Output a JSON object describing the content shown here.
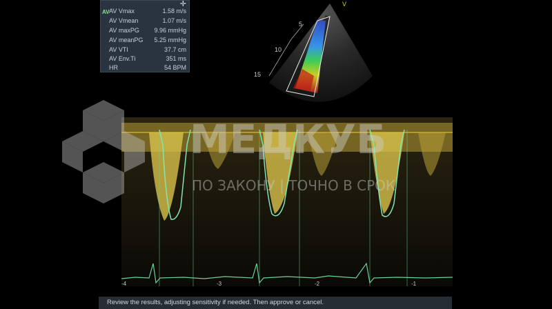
{
  "measurements": {
    "tag": "AV",
    "rows": [
      {
        "name": "AV Vmax",
        "value": "1.58 m/s"
      },
      {
        "name": "AV Vmean",
        "value": "1.07 m/s"
      },
      {
        "name": "AV maxPG",
        "value": "9.96 mmHg"
      },
      {
        "name": "AV meanPG",
        "value": "5.25 mmHg"
      },
      {
        "name": "AV VTI",
        "value": "37.7 cm"
      },
      {
        "name": "AV Env.Ti",
        "value": "351 ms"
      },
      {
        "name": "HR",
        "value": "54 BPM"
      }
    ],
    "close_symbol": "✛"
  },
  "sector_view": {
    "depth_labels": [
      "5",
      "10",
      "15"
    ],
    "orientation_marker": "V"
  },
  "doppler": {
    "time_labels": [
      "-4",
      "-3",
      "-2",
      "-1"
    ],
    "colors": {
      "spectrum": "#d8c24a",
      "trace": "#7fe6b0",
      "ecg": "#6ad39a"
    }
  },
  "watermark": {
    "title": "МЕДКУБ",
    "tagline": "ПО ЗАКОНУ | ТОЧНО В СРОК"
  },
  "status": {
    "message": "Review the results, adjusting sensitivity if needed. Then approve or cancel."
  }
}
